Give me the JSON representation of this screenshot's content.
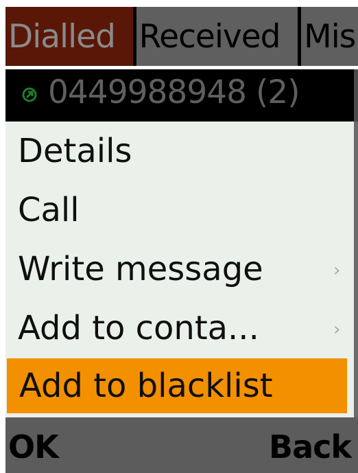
{
  "tabs": [
    {
      "label": "Dialled",
      "active": true
    },
    {
      "label": "Received",
      "active": false
    },
    {
      "label": "Mis",
      "active": false
    }
  ],
  "entry": {
    "icon": "dialled-call-arrow-icon",
    "number_text": "0449988948 (2)"
  },
  "menu": {
    "items": [
      {
        "label": "Details",
        "submenu": false,
        "selected": false
      },
      {
        "label": "Call",
        "submenu": false,
        "selected": false
      },
      {
        "label": "Write message",
        "submenu": true,
        "selected": false
      },
      {
        "label": "Add to conta...",
        "submenu": true,
        "selected": false
      },
      {
        "label": "Add to blacklist",
        "submenu": false,
        "selected": true
      }
    ],
    "chevron": "›"
  },
  "softkeys": {
    "left": "OK",
    "right": "Back"
  },
  "colors": {
    "active_tab": "#5a1707",
    "inactive_tab": "#5f5f5f",
    "menu_bg": "#eaf0ea",
    "selected": "#f39000",
    "softkey_bar": "#5c5c5c",
    "icon_green": "#1e7d2a"
  }
}
